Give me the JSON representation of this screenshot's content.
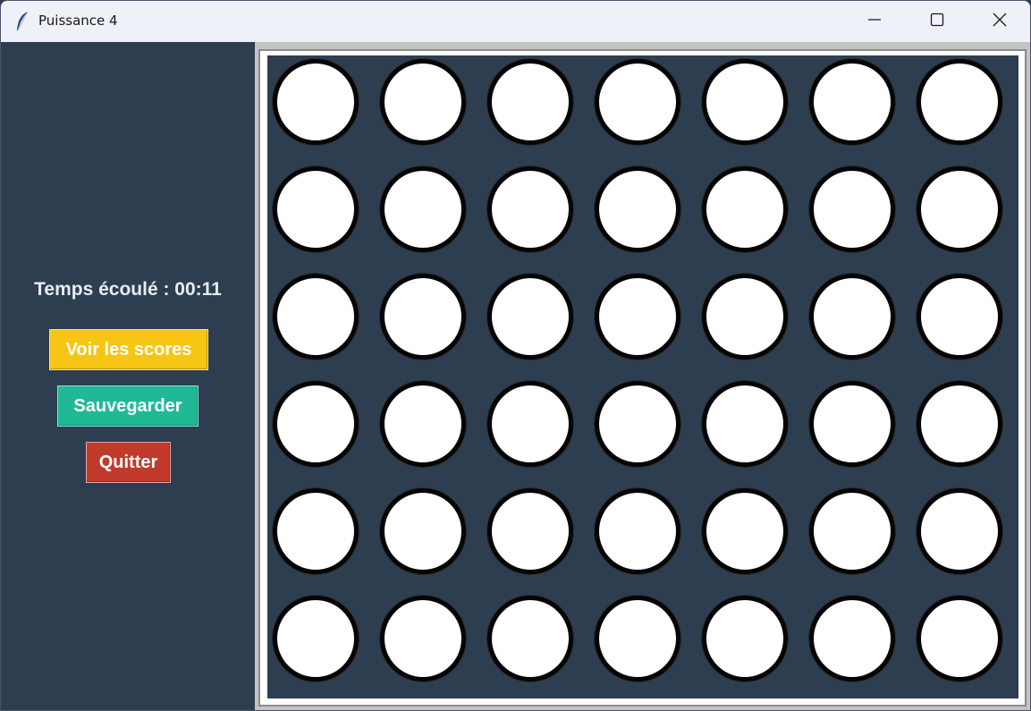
{
  "window": {
    "title": "Puissance 4",
    "app_icon": "feather-icon",
    "controls": [
      "minimize-icon",
      "maximize-icon",
      "close-icon"
    ]
  },
  "sidebar": {
    "timer_text": "Temps écoulé : 00:11",
    "buttons": {
      "scores": {
        "label": "Voir les scores",
        "color": "#f7c614"
      },
      "save": {
        "label": "Sauvegarder",
        "color": "#1fb996"
      },
      "quit": {
        "label": "Quitter",
        "color": "#c23a2c"
      }
    }
  },
  "board": {
    "rows": 6,
    "columns": 7,
    "cells": [
      [
        "empty",
        "empty",
        "empty",
        "empty",
        "empty",
        "empty",
        "empty"
      ],
      [
        "empty",
        "empty",
        "empty",
        "empty",
        "empty",
        "empty",
        "empty"
      ],
      [
        "empty",
        "empty",
        "empty",
        "empty",
        "empty",
        "empty",
        "empty"
      ],
      [
        "empty",
        "empty",
        "empty",
        "empty",
        "empty",
        "empty",
        "empty"
      ],
      [
        "empty",
        "empty",
        "empty",
        "empty",
        "empty",
        "empty",
        "empty"
      ],
      [
        "empty",
        "empty",
        "empty",
        "empty",
        "empty",
        "empty",
        "empty"
      ]
    ],
    "colors": {
      "background": "#2e3e51",
      "empty": "#ffffff",
      "outline": "#050505"
    }
  }
}
